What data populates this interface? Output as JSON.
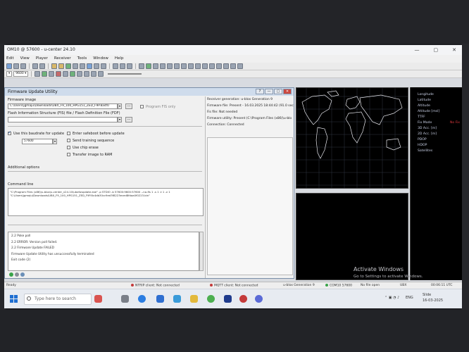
{
  "window": {
    "title": "OM10 @ 57600 - u-center 24.10",
    "ctrl_min": "—",
    "ctrl_max": "▢",
    "ctrl_close": "✕"
  },
  "menu": [
    "Edit",
    "View",
    "Player",
    "Receiver",
    "Tools",
    "Window",
    "Help"
  ],
  "toolbar": {
    "port_combo": "▾",
    "rate_combo": "9600 ▾"
  },
  "fw_dialog": {
    "title": "Firmware Update Utility",
    "btn_help": "?",
    "btn_min": "—",
    "btn_max": "▢",
    "btn_close": "✕",
    "firmware_image_label": "Firmware image",
    "firmware_image_path": "C:\\Users\\jgmaju\\Downloads\\UBX_F9_100_HPG151_ZED_F9P.8a4f0",
    "program_fis_only": "Program FIS only",
    "flash_info_label": "Flash Information Structure (FIS) file / Flash Definition File (FDF)",
    "flash_info_value": "",
    "use_baudrate_label": "Use this baudrate for update",
    "baudrate_value": "57600",
    "enter_safeboot": "Enter safeboot before update",
    "send_training": "Send training sequence",
    "use_chip_erase": "Use chip erase",
    "transfer_ram": "Transfer image to RAM",
    "additional_options_label": "Additional options",
    "command_line_label": "Command line",
    "command_line_text": "\"C:\\Program Files (x86)\\u-blox\\u-center_v24.10\\ubxfwupdate.exe\" -p STDIO -b 57600:9600:57600 --no-fis 1 -s 1 -t 1 -v 1 \"C:\\Users\\jgmaju\\Downloads\\UBX_F9_100_HPG151_ZED_F9P.8c4db30cc9ed3f8223eced8fdaa0f0223.bin\"",
    "log_lines": [
      "2.2     Poke poll",
      "2.2 ERROR: Version poll failed.",
      "2.2 Firmware Update FAILED",
      "Firmware Update Utility has unsuccessfully terminated",
      "Exit code (2)"
    ]
  },
  "receiver_info": {
    "generation": "Receiver generation: u-blox Generation 9",
    "firmware_file": "Firmware file: Present - 16.03.2025 18:44:42 (91.0 sec",
    "fis_file": "Fis file: Not needed",
    "firmware_utility": "Firmware utility: Present (C:\\Program Files (x86)\\u-blo",
    "connection": "Connection: Connected"
  },
  "data_panel": {
    "labels": [
      "Longitude",
      "Latitude",
      "Altitude",
      "Altitude [msl]",
      "TTFF",
      "Fix Mode",
      "3D Acc. [m]",
      "2D Acc. [m]",
      "PDOP",
      "HDOP",
      "Satellites"
    ],
    "fix_mode_value": "No Fix"
  },
  "watermark": {
    "title": "Activate Windows",
    "subtitle": "Go to Settings to activate Windows."
  },
  "statusbar": {
    "ready": "Ready",
    "ntrip": "NTRIP client: Not connected",
    "mqtt": "MQTT client: Not connected",
    "generation": "u-blox Generation 9",
    "port": "COM10 57600",
    "file": "No file open",
    "ubx": "UBX",
    "time": "00:06:11 UTC"
  },
  "taskbar": {
    "search_placeholder": "Type here to search",
    "lang": "ENG",
    "clock_time": "Slide",
    "clock_date": "16-03-2025"
  },
  "colors": {
    "accent": "#1f6fd1",
    "fix_error": "#e0393e"
  }
}
